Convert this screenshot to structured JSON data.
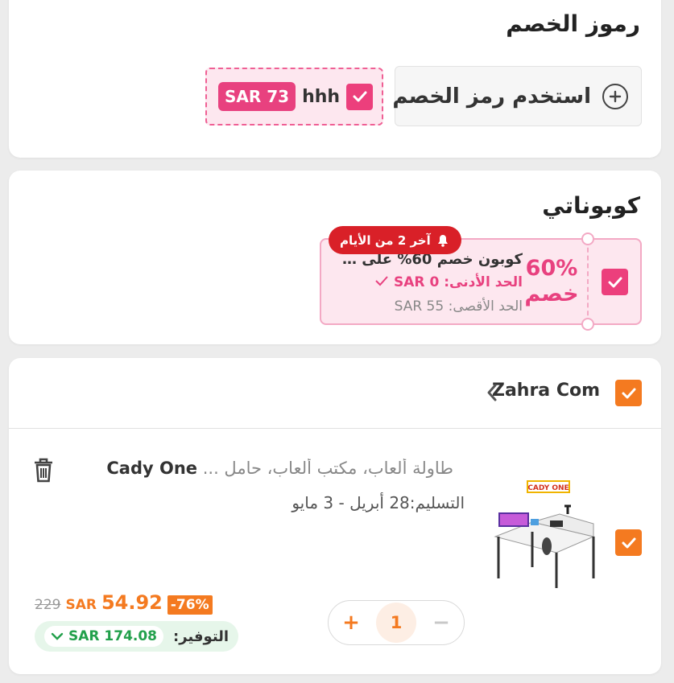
{
  "discount_codes": {
    "title": "رموز الخصم",
    "use_code_label": "استخدم رمز الخصم",
    "applied": {
      "code": "hhh",
      "amount": "SAR 73",
      "checked": true
    }
  },
  "my_coupons": {
    "title": "كوبوناتي",
    "coupon": {
      "percent": "60%",
      "percent_label": "خصم",
      "description": "كوبون خصم 60% على طلب...",
      "min_spend": "الحد الأدنى: SAR 0",
      "max_discount": "الحد الأقصى: SAR 55",
      "urgency": "آخر 2 من الأيام",
      "checked": true
    }
  },
  "cart": {
    "store_name": "Zahra Com",
    "item": {
      "brand": "Cady One",
      "title": "طاولة ألعاب، مكتب ألعاب، حامل ...",
      "delivery": "التسليم:28 أبريل - 3 مايو",
      "discount_badge": "-76%",
      "price": "54.92",
      "currency": "SAR",
      "old_price": "229",
      "savings_label": "التوفير:",
      "savings_amount": "SAR 174.08",
      "quantity": "1",
      "image_logo": "CADY ONE"
    }
  },
  "colors": {
    "pink": "#e8417f",
    "orange": "#f47a20",
    "green": "#22a04b",
    "red": "#d92028"
  }
}
